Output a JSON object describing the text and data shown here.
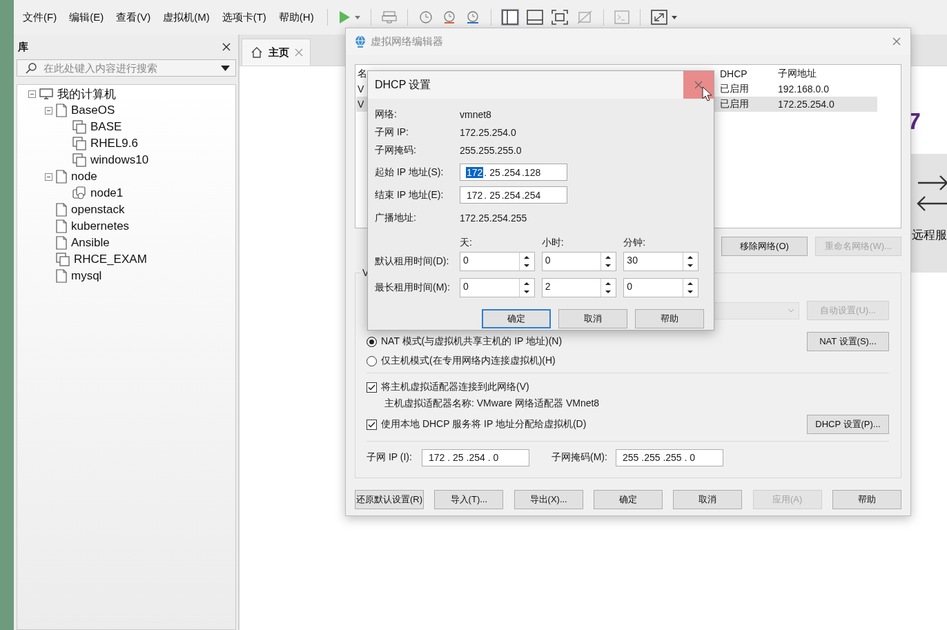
{
  "menu": [
    "文件(F)",
    "编辑(E)",
    "查看(V)",
    "虚拟机(M)",
    "选项卡(T)",
    "帮助(H)"
  ],
  "library": {
    "title": "库",
    "search": {
      "placeholder": "在此处键入内容进行搜索"
    },
    "tree": [
      {
        "label": "我的计算机",
        "kind": "computer",
        "expanded": true,
        "children": [
          {
            "label": "BaseOS",
            "kind": "folder",
            "expanded": true,
            "children": [
              {
                "label": "BASE",
                "kind": "vm"
              },
              {
                "label": "RHEL9.6",
                "kind": "vm"
              },
              {
                "label": "windows10",
                "kind": "vm"
              }
            ]
          },
          {
            "label": "node",
            "kind": "folder",
            "expanded": true,
            "children": [
              {
                "label": "node1",
                "kind": "linked-vm"
              }
            ]
          },
          {
            "label": "openstack",
            "kind": "folder"
          },
          {
            "label": "kubernetes",
            "kind": "folder"
          },
          {
            "label": "Ansible",
            "kind": "folder"
          },
          {
            "label": "RHCE_EXAM",
            "kind": "vm"
          },
          {
            "label": "mysql",
            "kind": "folder"
          }
        ]
      }
    ]
  },
  "tabs": [
    {
      "label": "主页",
      "selected": true
    }
  ],
  "home": {
    "logo_fragment": "7",
    "remote_label": "远程服"
  },
  "network_editor": {
    "title": "虚拟网络编辑器",
    "table": {
      "columns": [
        "名",
        "DHCP",
        "子网地址"
      ],
      "rows": [
        {
          "cells": [
            "V",
            "已启用",
            "192.168.0.0"
          ],
          "selected": false
        },
        {
          "cells": [
            "V",
            "已启用",
            "172.25.254.0"
          ],
          "selected": true
        }
      ]
    },
    "table_buttons": [
      {
        "label": "移除网络(O)",
        "disabled": false
      },
      {
        "label": "重命名网络(W)...",
        "disabled": true
      }
    ],
    "group_title": "V",
    "auto_button": {
      "label": "自动设置(U)...",
      "disabled": true
    },
    "radios": [
      {
        "label": "NAT 模式(与虚拟机共享主机的 IP 地址)(N)",
        "selected": true,
        "button": "NAT 设置(S)..."
      },
      {
        "label": "仅主机模式(在专用网络内连接虚拟机)(H)",
        "selected": false
      }
    ],
    "checkboxes": [
      {
        "label": "将主机虚拟适配器连接到此网络(V)",
        "checked": true,
        "note": "主机虚拟适配器名称: VMware 网络适配器 VMnet8"
      },
      {
        "label": "使用本地 DHCP 服务将 IP 地址分配给虚拟机(D)",
        "checked": true,
        "button": "DHCP 设置(P)..."
      }
    ],
    "subnet_ip": {
      "label": "子网 IP (I):",
      "value": "172 . 25 .254 . 0"
    },
    "subnet_mask": {
      "label": "子网掩码(M):",
      "value": "255 .255 .255 . 0"
    },
    "buttons": [
      {
        "label": "还原默认设置(R)",
        "disabled": false
      },
      {
        "label": "导入(T)...",
        "disabled": false
      },
      {
        "label": "导出(X)...",
        "disabled": false
      },
      {
        "label": "确定",
        "disabled": false
      },
      {
        "label": "取消",
        "disabled": false
      },
      {
        "label": "应用(A)",
        "disabled": true
      },
      {
        "label": "帮助",
        "disabled": false
      }
    ]
  },
  "dhcp_dialog": {
    "title": "DHCP 设置",
    "close_hovered": true,
    "info": [
      {
        "label": "网络:",
        "value": "vmnet8"
      },
      {
        "label": "子网 IP:",
        "value": "172.25.254.0"
      },
      {
        "label": "子网掩码:",
        "value": "255.255.255.0"
      }
    ],
    "ip_fields": [
      {
        "label": "起始 IP 地址(S):",
        "octets": [
          {
            "text": "172",
            "selected": true
          },
          {
            "text": ". 25",
            "selected": false
          },
          {
            "text": ".254",
            "selected": false
          },
          {
            "text": ".128",
            "selected": false
          }
        ]
      },
      {
        "label": "结束 IP 地址(E):",
        "octets": [
          {
            "text": "172",
            "selected": false
          },
          {
            "text": ". 25",
            "selected": false
          },
          {
            "text": ".254",
            "selected": false
          },
          {
            "text": ".254",
            "selected": false
          }
        ]
      }
    ],
    "broadcast": {
      "label": "广播地址:",
      "value": "172.25.254.255"
    },
    "lease_headers": [
      "天:",
      "小时:",
      "分钟:"
    ],
    "lease_rows": [
      {
        "label": "默认租用时间(D):",
        "values": [
          "0",
          "0",
          "30"
        ]
      },
      {
        "label": "最长租用时间(M):",
        "values": [
          "0",
          "2",
          "0"
        ]
      }
    ],
    "buttons": [
      {
        "label": "确定",
        "focused": true
      },
      {
        "label": "取消",
        "focused": false
      },
      {
        "label": "帮助",
        "focused": false
      }
    ]
  }
}
